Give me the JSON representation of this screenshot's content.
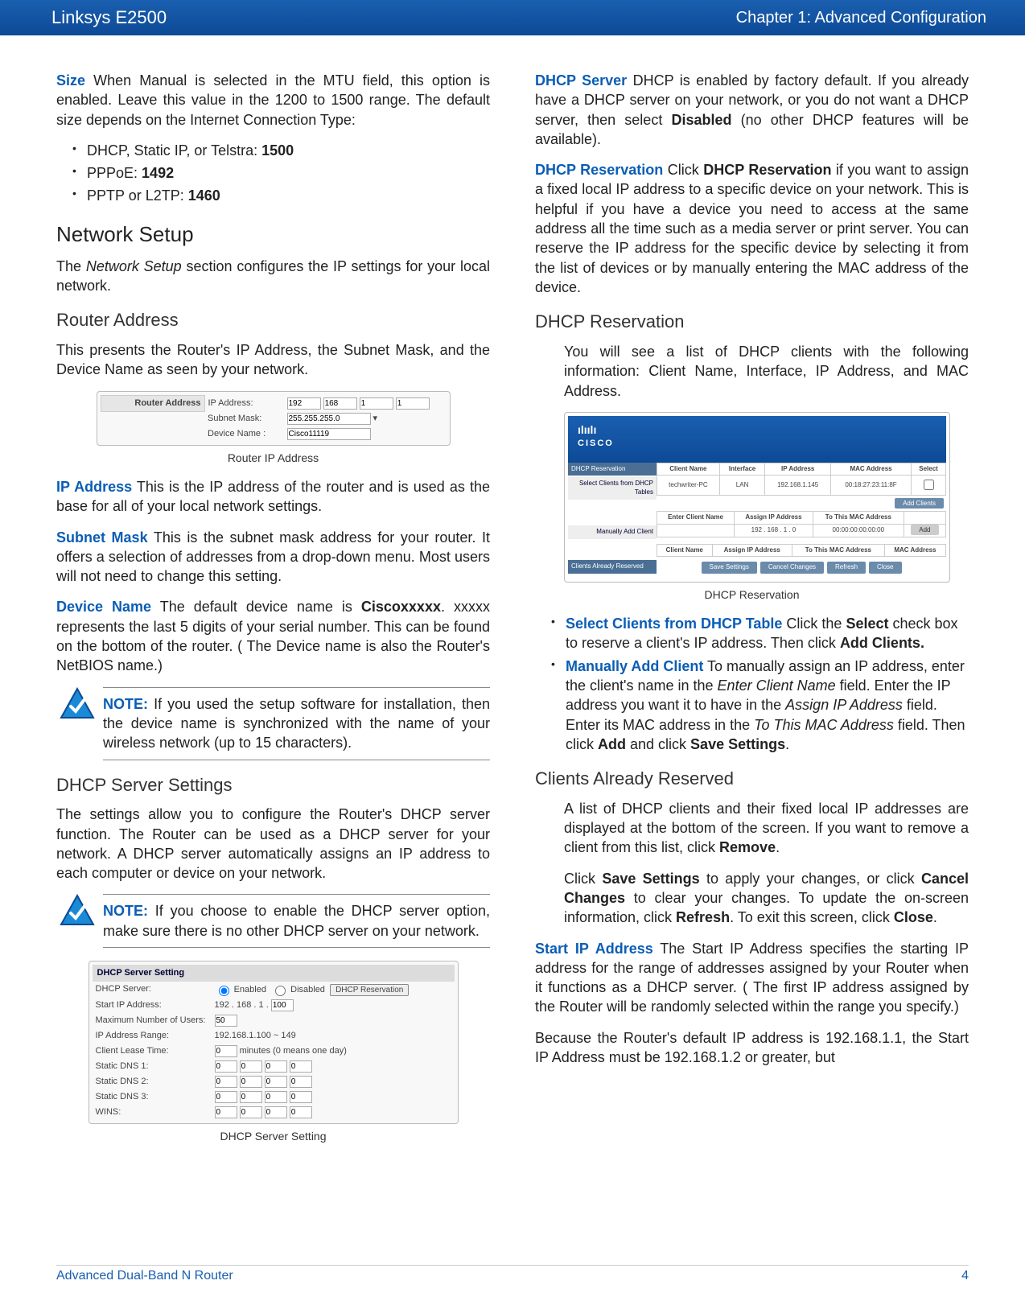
{
  "header": {
    "product": "Linksys E2500",
    "chapter": "Chapter 1: Advanced Configuration"
  },
  "footer": {
    "model_text": "Advanced Dual-Band N Router",
    "page_number": "4"
  },
  "left": {
    "size_para": "  When Manual is selected in the MTU field, this option is enabled. Leave this value in the 1200 to 1500 range. The default size depends on the Internet Connection Type:",
    "size_term": "Size",
    "bullets": [
      {
        "pre": "DHCP, Static IP, or Telstra: ",
        "bold": "1500"
      },
      {
        "pre": "PPPoE: ",
        "bold": "1492"
      },
      {
        "pre": "PPTP or L2TP: ",
        "bold": "1460"
      }
    ],
    "h_network_setup": "Network Setup",
    "p_network_setup": "The Network Setup section configures the IP settings for your local network.",
    "h_router_address": "Router Address",
    "p_router_address": "This presents the Router's IP Address, the Subnet Mask, and the Device Name as seen by your network.",
    "fig_router": {
      "title": "Router Address",
      "rows": {
        "ip_label": "IP Address:",
        "ip": [
          "192",
          "168",
          "1",
          "1"
        ],
        "mask_label": "Subnet Mask:",
        "mask": "255.255.255.0",
        "dev_label": "Device Name :",
        "dev": "Cisco11119"
      },
      "caption": "Router IP Address"
    },
    "ip_term": "IP Address",
    "ip_para": "  This is the IP address of the router and is used as the base for all of your local network settings.",
    "mask_term": "Subnet Mask",
    "mask_para": "  This is the subnet mask address for your router. It offers a selection of addresses from a drop-down menu. Most users will not need to change this setting.",
    "dev_term": "Device Name",
    "dev_para1": "  The default device name is ",
    "dev_bold": "Ciscoxxxxx",
    "dev_para2": ". xxxxx represents the last 5 digits of your serial number. This can be found on the bottom of the router. ( The Device name is also the Router's NetBIOS name.)",
    "note1_label": "NOTE:",
    "note1_text": " If you used the setup software for installation, then the device name is synchronized with the name of your wireless network (up to 15 characters).",
    "h_dhcp_settings": "DHCP Server Settings",
    "p_dhcp_settings": "The settings allow you to configure the Router's DHCP server function. The Router can be used as a DHCP server for your network. A DHCP server automatically assigns an IP address to each computer or device on your network.",
    "note2_label": "NOTE:",
    "note2_text": " If you choose to enable the DHCP server option, make sure there is no other DHCP server on your network.",
    "fig_dhcp": {
      "hdr": "DHCP Server Setting",
      "rows": {
        "server_lbl": "DHCP Server:",
        "enabled": "Enabled",
        "disabled": "Disabled",
        "btn": "DHCP Reservation",
        "start_lbl": "Start IP Address:",
        "start": "192 . 168 . 1 . ",
        "start_v": "100",
        "max_lbl": "Maximum Number of Users:",
        "max": "50",
        "range_lbl": "IP Address Range:",
        "range": "192.168.1.100 ~ 149",
        "lease_lbl": "Client Lease Time:",
        "lease": "0",
        "lease_unit": "minutes (0 means one day)",
        "dns1_lbl": "Static DNS 1:",
        "dns": [
          "0",
          "0",
          "0",
          "0"
        ],
        "dns2_lbl": "Static DNS 2:",
        "dns3_lbl": "Static DNS 3:",
        "wins_lbl": "WINS:"
      },
      "caption": "DHCP Server Setting"
    }
  },
  "right": {
    "dhcp_server_term": "DHCP Server",
    "dhcp_server_para": "  DHCP is enabled by factory default. If you already have a DHCP server on your network, or you do not want a DHCP server, then select ",
    "dhcp_server_bold": "Disabled",
    "dhcp_server_para2": " (no other DHCP features will be available).",
    "dhcp_res_term": "DHCP Reservation",
    "dhcp_res_p1": "  Click ",
    "dhcp_res_b1": "DHCP Reservation",
    "dhcp_res_p2": " if you want to assign a fixed local IP address to a specific device on your network. This is helpful if you have a device you need to access at the same address all the time such as a media server or print server. You can reserve the IP address for the specific device by selecting it from the list of devices or by manually entering the MAC address of the device.",
    "h_dhcp_reservation": "DHCP Reservation",
    "dhcp_res_list_para": "You will see a list of DHCP clients with the following information: Client Name, Interface, IP Address, and MAC Address.",
    "fig_res": {
      "logo": "ılıılı CISCO",
      "tabs": [
        "DHCP Reservation",
        "Select Clients from DHCP Tables",
        "Manually Add Client",
        "Clients Already Reserved"
      ],
      "t1_headers": [
        "Client Name",
        "Interface",
        "IP Address",
        "MAC Address",
        "Select"
      ],
      "t1_row": [
        "techwriter-PC",
        "LAN",
        "192.168.1.145",
        "00:18:27:23:11:8F",
        ""
      ],
      "t1_btn": "Add Clients",
      "t2_headers": [
        "Enter Client Name",
        "Assign IP Address",
        "To This MAC Address",
        ""
      ],
      "t2_row": [
        "",
        "192 . 168 . 1 . 0",
        "00:00:00:00:00:00",
        "Add"
      ],
      "t3_headers": [
        "Client Name",
        "Assign IP Address",
        "To This MAC Address",
        "MAC Address"
      ],
      "btns": [
        "Save Settings",
        "Cancel Changes",
        "Refresh",
        "Close"
      ],
      "caption": "DHCP Reservation"
    },
    "li1_term": "Select Clients from DHCP Table",
    "li1_p1": " Click the ",
    "li1_b1": "Select",
    "li1_p2": " check box to reserve a client's IP address. Then click ",
    "li1_b2": "Add Clients.",
    "li2_term": "Manually Add Client",
    "li2_p1": " To manually assign an IP address, enter the client's name in the ",
    "li2_i1": "Enter Client Name",
    "li2_p2": " field. Enter the IP address you want it to have in the ",
    "li2_i2": "Assign IP Address",
    "li2_p3": " field. Enter its MAC address in the ",
    "li2_i3": "To This MAC Address",
    "li2_p4": " field. Then click ",
    "li2_b1": "Add",
    "li2_p5": " and click ",
    "li2_b2": "Save Settings",
    "li2_p6": ".",
    "h_clients_reserved": "Clients Already Reserved",
    "cr_p1": "A list of DHCP clients and their fixed local IP addresses are displayed at the bottom of the screen. If you want to remove a client from this list, click ",
    "cr_b1": "Remove",
    "cr_p1b": ".",
    "cr_p2a": "Click ",
    "cr_b2": "Save Settings",
    "cr_p2b": " to apply your changes, or click ",
    "cr_b3": "Cancel Changes",
    "cr_p2c": " to clear your changes. To update the on-screen information, click ",
    "cr_b4": "Refresh",
    "cr_p2d": ". To exit this screen, click ",
    "cr_b5": "Close",
    "cr_p2e": ".",
    "start_ip_term": "Start IP Address",
    "start_ip_para": "  The Start IP Address specifies the starting IP address for the range of addresses assigned by your Router when it functions as a DHCP server. ( The first IP address assigned by the Router will be randomly selected within the range you specify.)",
    "last_para": "Because the Router's default IP address is 192.168.1.1, the Start IP Address must be 192.168.1.2 or greater, but"
  }
}
